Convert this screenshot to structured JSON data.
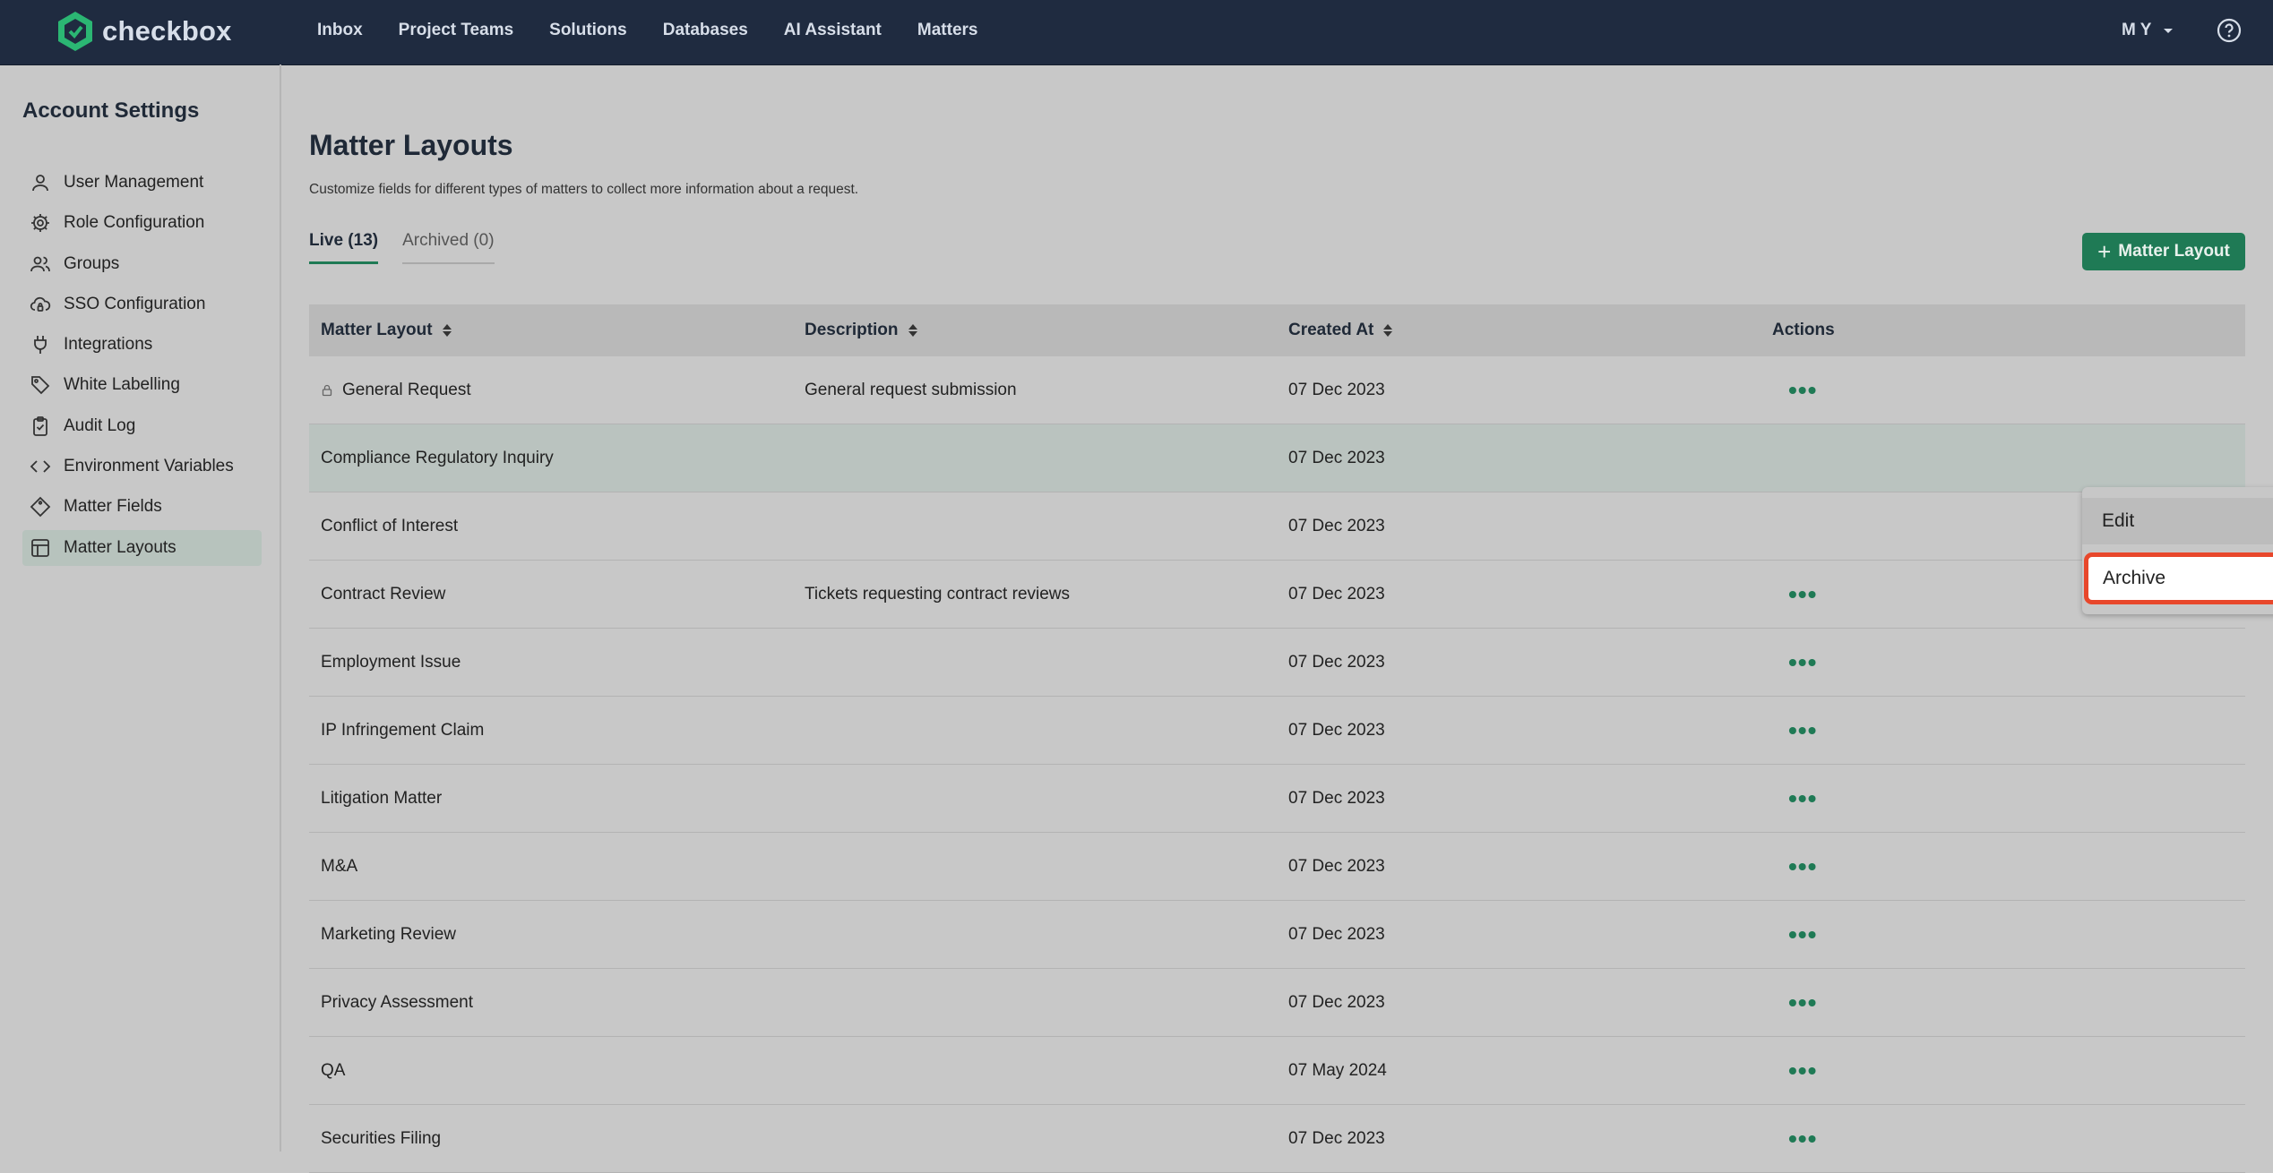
{
  "brand": {
    "name": "checkbox"
  },
  "nav": {
    "items": [
      "Inbox",
      "Project Teams",
      "Solutions",
      "Databases",
      "AI Assistant",
      "Matters"
    ],
    "user": "M Y"
  },
  "sidebar": {
    "title": "Account Settings",
    "items": [
      {
        "label": "User Management",
        "icon": "user-icon"
      },
      {
        "label": "Role Configuration",
        "icon": "gear-icon"
      },
      {
        "label": "Groups",
        "icon": "users-icon"
      },
      {
        "label": "SSO Configuration",
        "icon": "cloud-lock-icon"
      },
      {
        "label": "Integrations",
        "icon": "plug-icon"
      },
      {
        "label": "White Labelling",
        "icon": "tag-icon"
      },
      {
        "label": "Audit Log",
        "icon": "clipboard-check-icon"
      },
      {
        "label": "Environment Variables",
        "icon": "code-icon"
      },
      {
        "label": "Matter Fields",
        "icon": "diamond-icon"
      },
      {
        "label": "Matter Layouts",
        "icon": "layout-icon"
      }
    ],
    "active": "Matter Layouts"
  },
  "main": {
    "title": "Matter Layouts",
    "description": "Customize fields for different types of matters to collect more information about a request.",
    "tabs": [
      {
        "label": "Live (13)"
      },
      {
        "label": "Archived (0)"
      }
    ],
    "add_button": "Matter Layout",
    "table": {
      "headers": [
        "Matter Layout",
        "Description",
        "Created At",
        "Actions"
      ],
      "rows": [
        {
          "name": "General Request",
          "description": "General request submission",
          "created": "07 Dec 2023",
          "locked": true
        },
        {
          "name": "Compliance Regulatory Inquiry",
          "description": "",
          "created": "07 Dec 2023"
        },
        {
          "name": "Conflict of Interest",
          "description": "",
          "created": "07 Dec 2023"
        },
        {
          "name": "Contract Review",
          "description": "Tickets requesting contract reviews",
          "created": "07 Dec 2023"
        },
        {
          "name": "Employment Issue",
          "description": "",
          "created": "07 Dec 2023"
        },
        {
          "name": "IP Infringement Claim",
          "description": "",
          "created": "07 Dec 2023"
        },
        {
          "name": "Litigation Matter",
          "description": "",
          "created": "07 Dec 2023"
        },
        {
          "name": "M&A",
          "description": "",
          "created": "07 Dec 2023"
        },
        {
          "name": "Marketing Review",
          "description": "",
          "created": "07 Dec 2023"
        },
        {
          "name": "Privacy Assessment",
          "description": "",
          "created": "07 Dec 2023"
        },
        {
          "name": "QA",
          "description": "",
          "created": "07 May 2024"
        },
        {
          "name": "Securities Filing",
          "description": "",
          "created": "07 Dec 2023"
        }
      ]
    },
    "dropdown": {
      "items": [
        "Edit",
        "Archive"
      ]
    }
  },
  "colors": {
    "brand_green": "#1f7a55",
    "nav_bg": "#1f2b40",
    "highlight": "#e8472b"
  }
}
